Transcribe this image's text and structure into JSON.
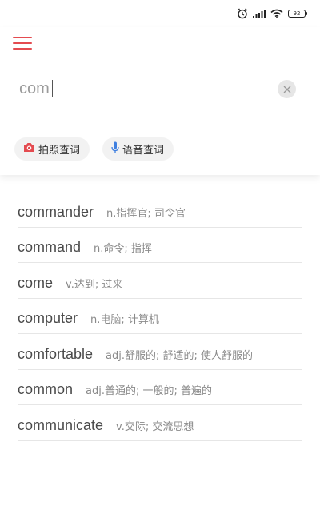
{
  "status_bar": {
    "icons": [
      "alarm-icon",
      "signal-icon",
      "wifi-icon"
    ],
    "battery_level": "92"
  },
  "header": {
    "menu_icon": "hamburger-menu-icon",
    "accent_color": "#e44b50"
  },
  "search": {
    "value": "com",
    "clear_icon": "close-icon"
  },
  "quick_actions": [
    {
      "label": "拍照查词",
      "icon": "camera-icon",
      "icon_color": "#e44b50"
    },
    {
      "label": "语音查词",
      "icon": "microphone-icon",
      "icon_color": "#3f7fe0"
    }
  ],
  "suggestions": [
    {
      "word": "commander",
      "definition": "n.指挥官; 司令官"
    },
    {
      "word": "command",
      "definition": "n.命令; 指挥"
    },
    {
      "word": "come",
      "definition": "v.达到; 过来"
    },
    {
      "word": "computer",
      "definition": "n.电脑; 计算机"
    },
    {
      "word": "comfortable",
      "definition": "adj.舒服的; 舒适的; 使人舒服的"
    },
    {
      "word": "common",
      "definition": "adj.普通的; 一般的; 普遍的"
    },
    {
      "word": "communicate",
      "definition": "v.交际; 交流思想"
    }
  ]
}
